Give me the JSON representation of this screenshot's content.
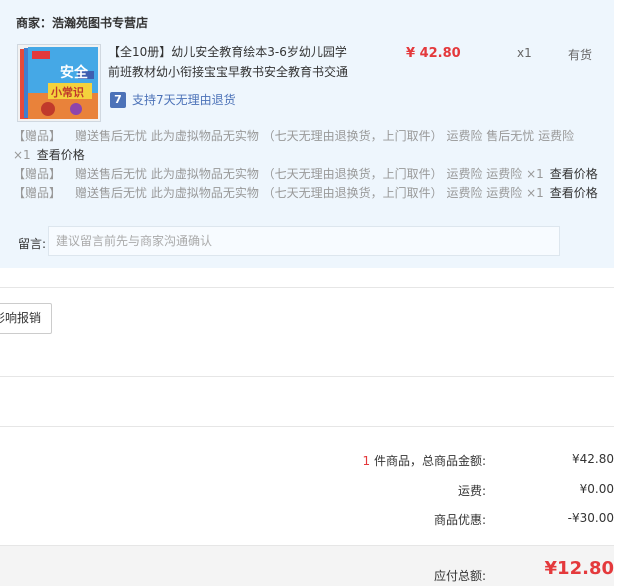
{
  "shop": {
    "label": "商家：",
    "name": "浩瀚苑图书专营店"
  },
  "product": {
    "title": "【全10册】幼儿安全教育绘本3-6岁幼儿园学前班教材幼小衔接宝宝早教书安全教育书交通",
    "thumb_text_top": "安全",
    "thumb_text_bottom": "小常识",
    "price": "¥ 42.80",
    "quantity": "x1",
    "stock": "有货",
    "return_icon": "7",
    "return_text": "支持7天无理由退货"
  },
  "gifts": {
    "tag": "【赠品】",
    "desc": "赠送售后无忧 此为虚拟物品无实物 （七天无理由退换货，上门取件） 运费险 售后无忧 运费险",
    "qty_line": "×1",
    "view_price": "查看价格",
    "desc2": "赠送售后无忧 此为虚拟物品无实物 （七天无理由退换货，上门取件） 运费险 运费险 ×1",
    "desc3": "赠送售后无忧 此为虚拟物品无实物 （七天无理由退换货，上门取件） 运费险 运费险 ×1"
  },
  "message": {
    "label": "留言:",
    "placeholder": "建议留言前先与商家沟通确认"
  },
  "report_button": "影响报销",
  "summary": {
    "count": "1",
    "count_suffix": " 件商品，总商品金额:",
    "goods_total": "¥42.80",
    "shipping_label": "运费:",
    "shipping": "¥0.00",
    "discount_label": "商品优惠:",
    "discount": "-¥30.00",
    "payable_label": "应付总额:",
    "payable": "¥12.80"
  },
  "colors": {
    "accent": "#e4393c",
    "link_blue": "#4c72b8",
    "panel_bg": "#eef6fd"
  }
}
